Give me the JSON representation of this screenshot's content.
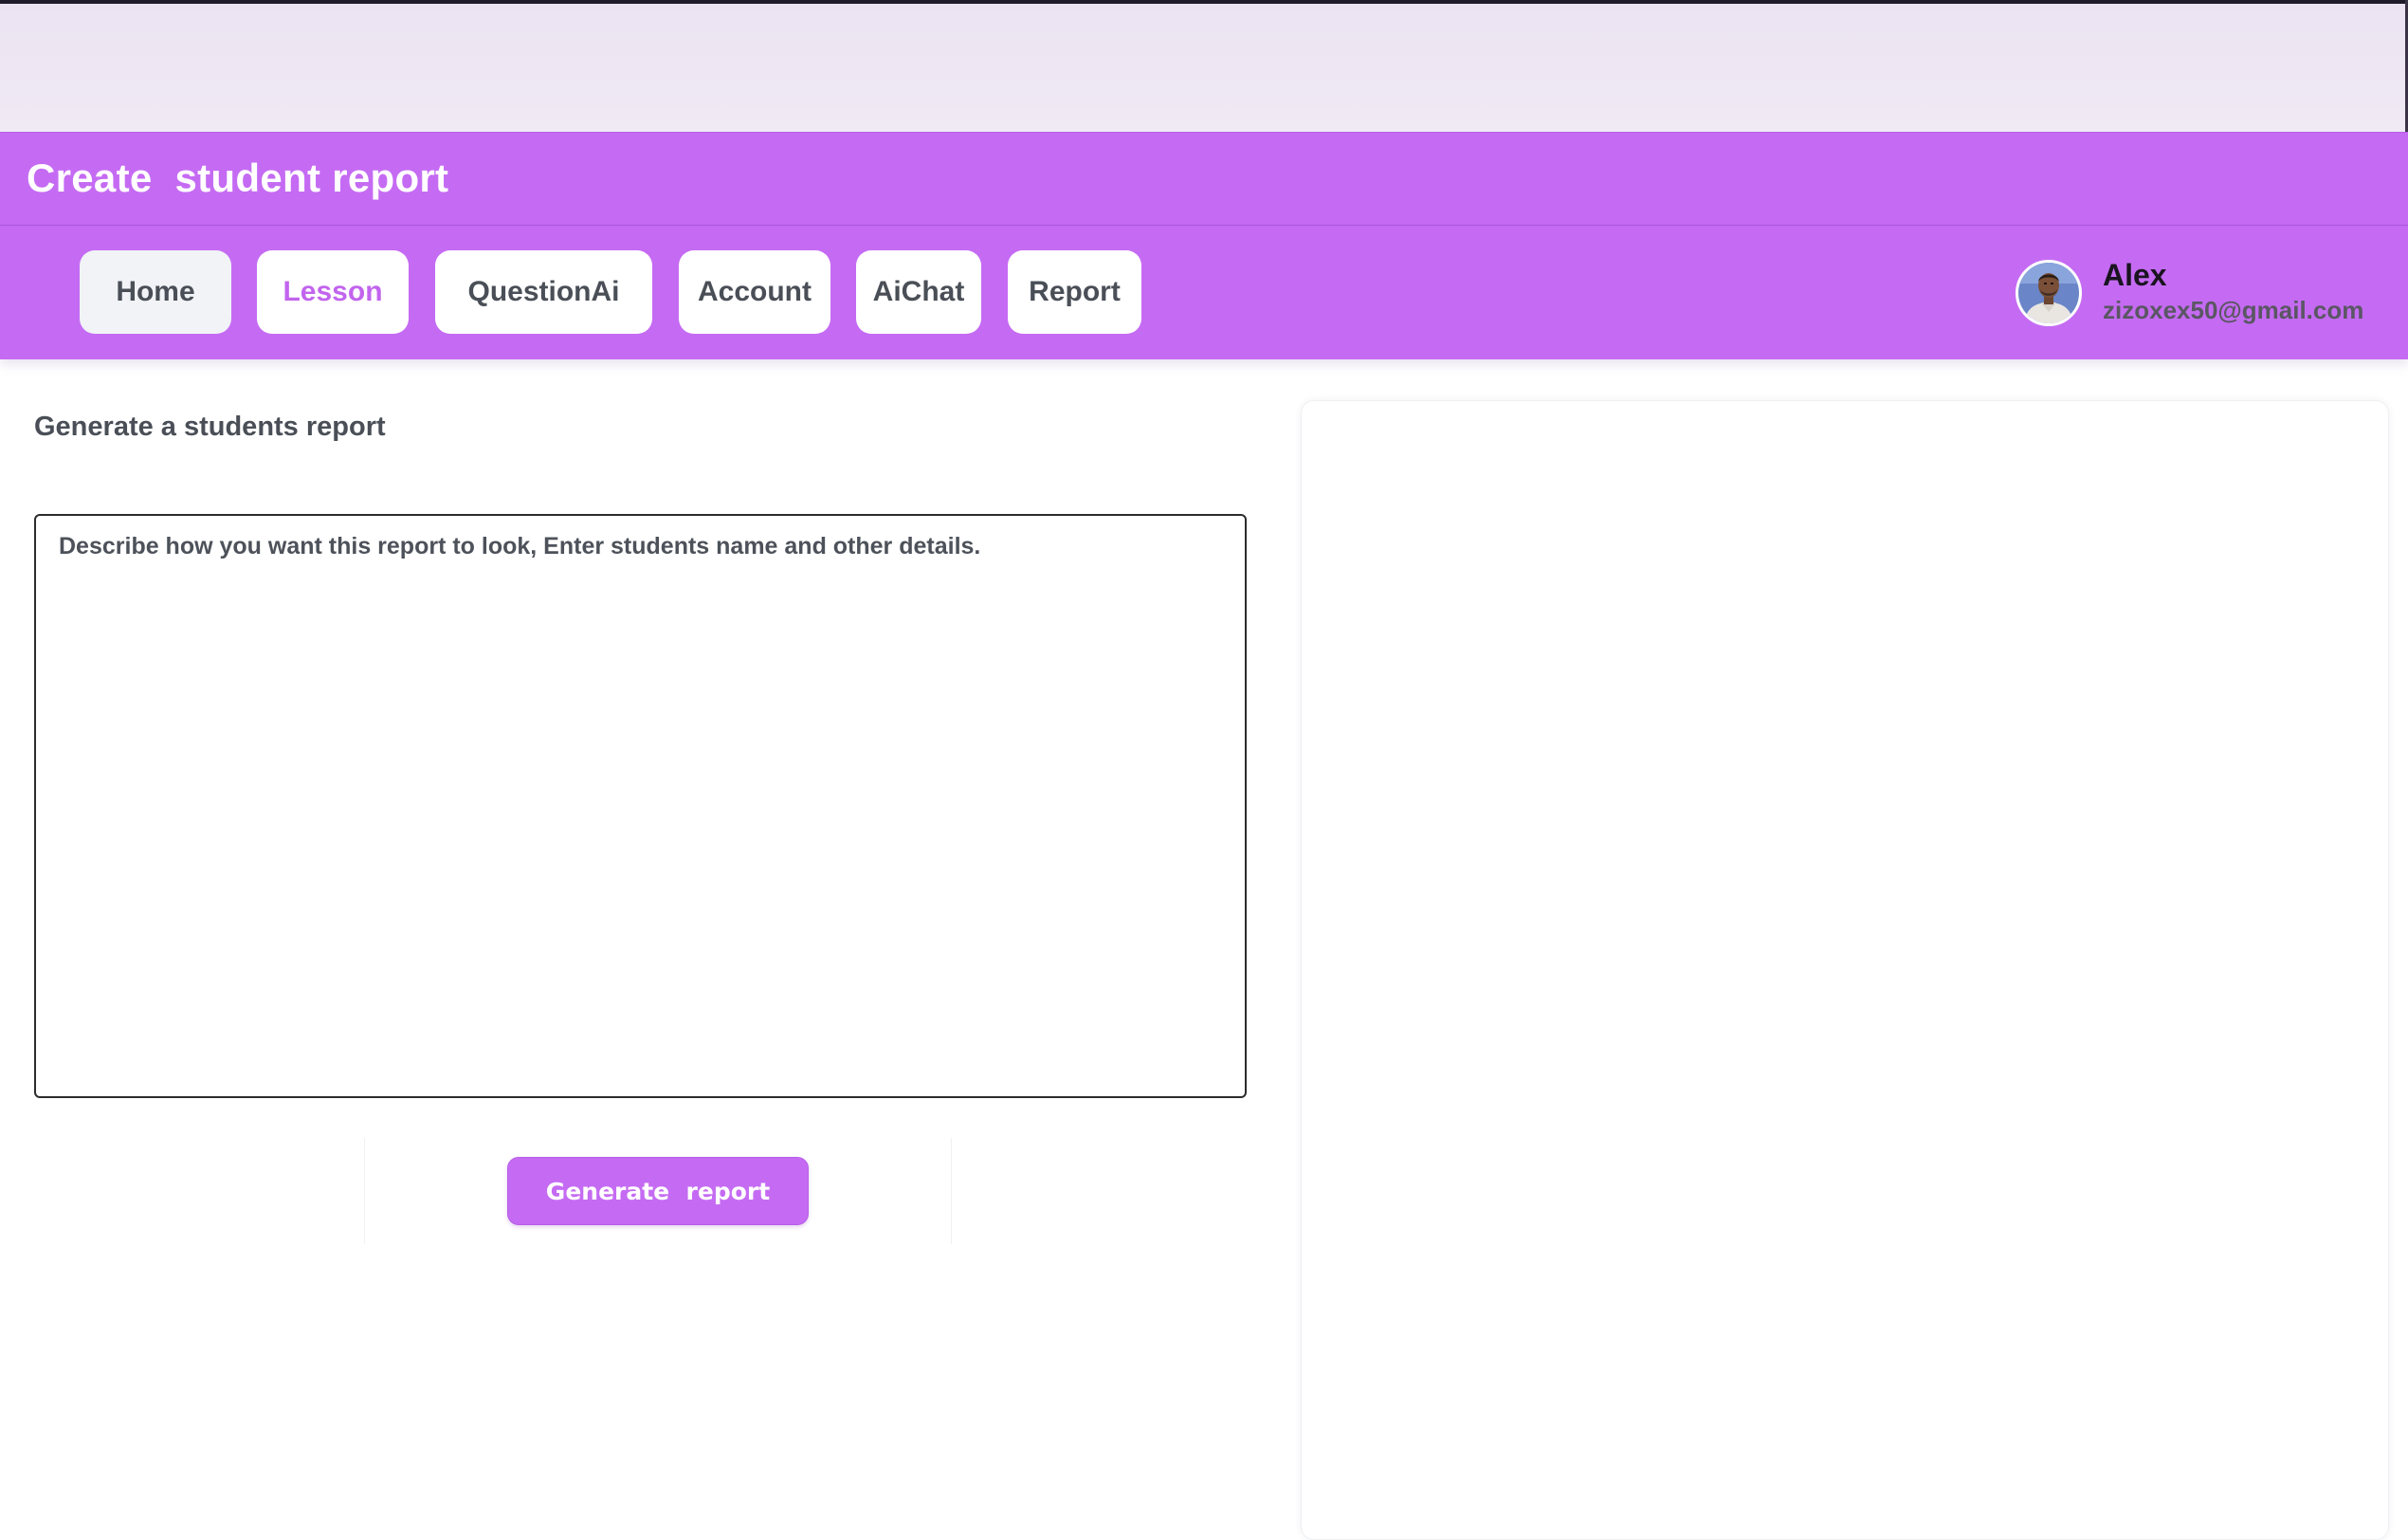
{
  "header": {
    "title": "Create  student report"
  },
  "nav": {
    "items": [
      {
        "label": "Home"
      },
      {
        "label": "Lesson"
      },
      {
        "label": "QuestionAi"
      },
      {
        "label": "Account"
      },
      {
        "label": "AiChat"
      },
      {
        "label": "Report"
      }
    ],
    "active": "Lesson"
  },
  "user": {
    "name": "Alex",
    "email": "zizoxex50@gmail.com",
    "avatar_icon": "user-photo"
  },
  "form": {
    "heading": "Generate a students report",
    "textarea_placeholder": "Describe how you want this report to look, Enter students name and other details.",
    "textarea_value": "",
    "submit_label": "Generate  report"
  },
  "colors": {
    "accent": "#c56bf3",
    "active_nav_text": "#c264ee",
    "text_gray": "#4a4f57"
  }
}
